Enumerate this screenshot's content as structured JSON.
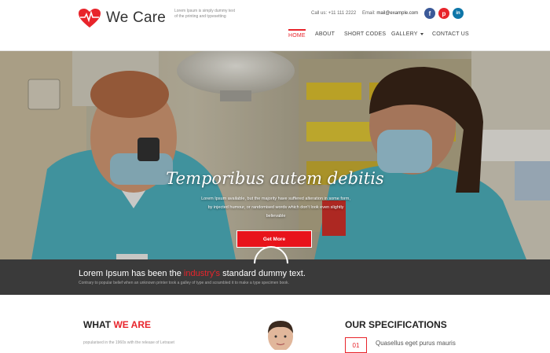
{
  "header": {
    "logo_text": "We Care",
    "tagline": "Lorem Ipsum is simply dummy text of the printing and typesetting",
    "call_label": "Call us:",
    "phone": "+11 111 2222",
    "email_label": "Email:",
    "email": "mail@example.com",
    "social": [
      {
        "icon": "facebook-icon",
        "glyph": "f",
        "color": "#3b5998"
      },
      {
        "icon": "pinterest-icon",
        "glyph": "p",
        "color": "#e8242b"
      },
      {
        "icon": "linkedin-icon",
        "glyph": "in",
        "color": "#0e76a8"
      }
    ],
    "nav": [
      "Home",
      "About",
      "Short Codes",
      "Gallery",
      "Contact Us"
    ]
  },
  "hero": {
    "title": "Temporibus autem debitis",
    "subtitle": "Lorem Ipsum available, but the majority have suffered alteration in some form, by injected humour, or randomised words which don't look even slightly believable",
    "button": "Get More"
  },
  "band": {
    "title_before": "Lorem Ipsum has been the ",
    "title_highlight": "industry's",
    "title_after": " standard dummy text.",
    "subtitle": "Contrary to popular belief when an unknown printer took a galley of type and scrambled it to make a type specimen book."
  },
  "what": {
    "title_before": "WHAT ",
    "title_highlight": "WE ARE",
    "text": "popularised in the 1960s with the release of Letraset"
  },
  "specs": {
    "title": "OUR SPECIFICATIONS",
    "number": "01",
    "item": "Quasellus eget purus mauris"
  },
  "colors": {
    "accent": "#e8242b",
    "band": "#3a3a3a"
  }
}
